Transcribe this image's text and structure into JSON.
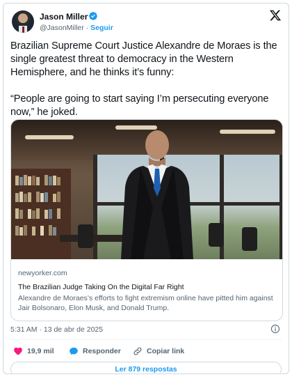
{
  "author": {
    "name": "Jason Miller",
    "handle": "@JasonMiller",
    "separator": "·",
    "follow_label": "Seguir"
  },
  "tweet": {
    "paragraphs": [
      "Brazilian Supreme Court Justice Alexandre de Moraes is the single greatest threat to democracy in the Western Hemisphere, and he thinks it’s funny:",
      "“People are going to start saying I’m persecuting everyone now,” he joked."
    ]
  },
  "link_card": {
    "domain": "newyorker.com",
    "title": "The Brazilian Judge Taking On the Digital Far Right",
    "description": "Alexandre de Moraes’s efforts to fight extremism online have pitted him against Jair Bolsonaro, Elon Musk, and Donald Trump."
  },
  "timestamp": "5:31 AM · 13 de abr de 2025",
  "actions": {
    "likes": "19,9 mil",
    "reply_label": "Responder",
    "copy_label": "Copiar link"
  },
  "read_replies_label": "Ler 879 respostas",
  "colors": {
    "accent": "#1d9bf0",
    "like": "#f91880",
    "text": "#0f1419",
    "muted": "#536471",
    "border": "#cfd9de"
  },
  "icons": [
    "verified-badge-icon",
    "x-logo-icon",
    "info-icon",
    "heart-icon",
    "reply-bubble-icon",
    "link-icon"
  ]
}
